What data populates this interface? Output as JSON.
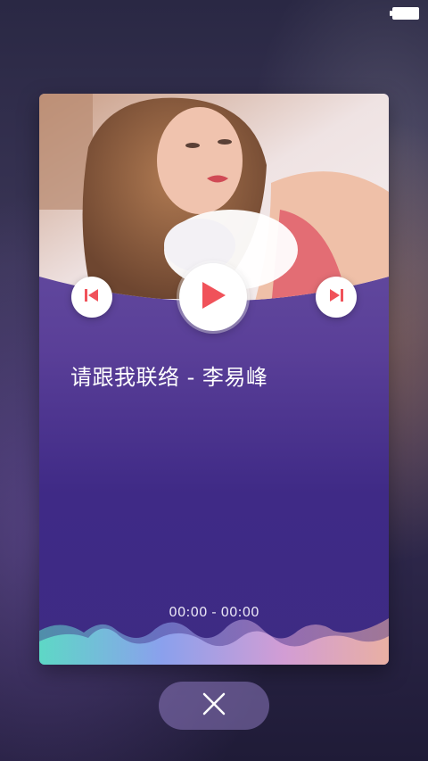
{
  "song": {
    "title": "请跟我联络 - 李易峰",
    "time": "00:00 - 00:00"
  },
  "controls": {
    "prev_icon": "skip-previous-icon",
    "play_icon": "play-icon",
    "next_icon": "skip-next-icon",
    "close_icon": "close-icon"
  },
  "colors": {
    "accent": "#f0525a",
    "card_top": "#6e5aa8",
    "card_bottom": "#3d2b84"
  }
}
